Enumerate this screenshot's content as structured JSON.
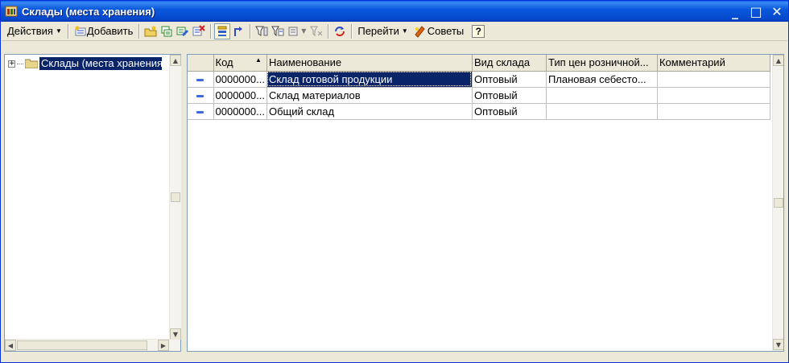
{
  "window": {
    "title": "Склады (места хранения)",
    "controls": {
      "minimize": "_",
      "maximize": "□",
      "close": "✕"
    }
  },
  "toolbar": {
    "actions_label": "Действия",
    "add_label": "Добавить",
    "goto_label": "Перейти",
    "tips_label": "Советы",
    "help_label": "?"
  },
  "tree": {
    "root_label": "Склады (места хранения)"
  },
  "grid": {
    "columns": [
      "Код",
      "Наименование",
      "Вид склада",
      "Тип цен розничной...",
      "Комментарий"
    ],
    "rows": [
      {
        "code": "0000000...",
        "name": "Склад готовой продукции",
        "type": "Оптовый",
        "price_type": "Плановая себесто...",
        "comment": ""
      },
      {
        "code": "0000000...",
        "name": "Склад материалов",
        "type": "Оптовый",
        "price_type": "",
        "comment": ""
      },
      {
        "code": "0000000...",
        "name": "Общий склад",
        "type": "Оптовый",
        "price_type": "",
        "comment": ""
      }
    ]
  },
  "colors": {
    "title_bar": "#0a58dc",
    "selection": "#0a246a",
    "face": "#ece9d8"
  }
}
